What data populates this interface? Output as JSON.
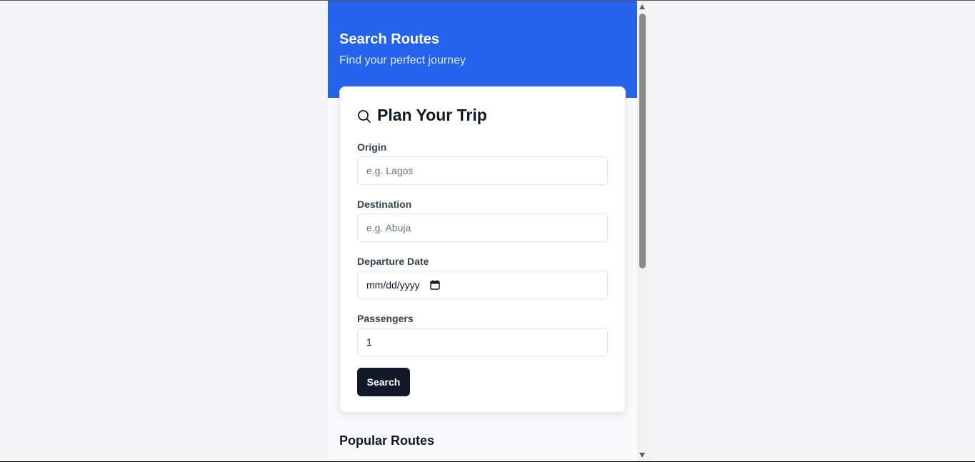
{
  "header": {
    "title": "Search Routes",
    "subtitle": "Find your perfect journey"
  },
  "form": {
    "title": "Plan Your Trip",
    "title_icon": "search-icon",
    "origin": {
      "label": "Origin",
      "placeholder": "e.g. Lagos",
      "value": ""
    },
    "destination": {
      "label": "Destination",
      "placeholder": "e.g. Abuja",
      "value": ""
    },
    "departure_date": {
      "label": "Departure Date",
      "value": "mm/dd/yyyy",
      "icon": "calendar-icon"
    },
    "passengers": {
      "label": "Passengers",
      "value": "1"
    },
    "search_label": "Search"
  },
  "popular_routes": {
    "title": "Popular Routes"
  },
  "colors": {
    "header_bg": "#2563eb",
    "button_bg": "#111827"
  }
}
